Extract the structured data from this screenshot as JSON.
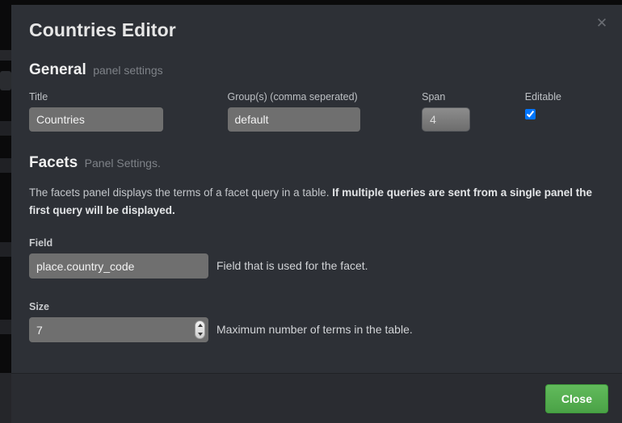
{
  "colors": {
    "modal_background": "#2d3036",
    "footer_background": "#2a2c31",
    "input_background": "#6f6f6f",
    "accent_green": "#62bb5c",
    "text_primary": "#e6e6e6",
    "text_muted": "#7e8288"
  },
  "header": {
    "title": "Countries Editor",
    "close_icon": "close-icon",
    "close_glyph": "✕"
  },
  "general": {
    "heading": "General",
    "heading_suffix": "panel settings",
    "title_field": {
      "label": "Title",
      "value": "Countries",
      "placeholder": ""
    },
    "groups_field": {
      "label": "Group(s) (comma seperated)",
      "value": "default",
      "placeholder": ""
    },
    "span_field": {
      "label": "Span",
      "value": "4"
    },
    "editable_field": {
      "label": "Editable",
      "checked": true
    }
  },
  "facets": {
    "heading": "Facets",
    "heading_suffix": "Panel Settings.",
    "description_plain": "The facets panel displays the terms of a facet query in a table. ",
    "description_bold": "If multiple queries are sent from a single panel the first query will be displayed.",
    "field": {
      "label": "Field",
      "value": "place.country_code",
      "help": "Field that is used for the facet."
    },
    "size": {
      "label": "Size",
      "value": "7",
      "help": "Maximum number of terms in the table.",
      "spinner_icon": "spinner-arrows-icon"
    }
  },
  "footer": {
    "close_button_label": "Close"
  }
}
